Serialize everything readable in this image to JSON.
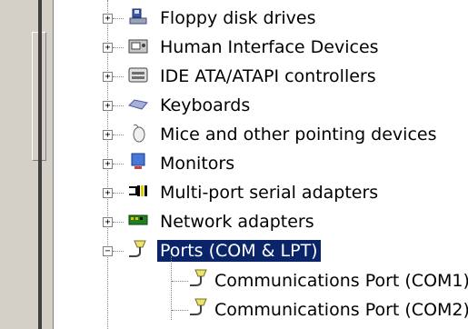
{
  "tree": {
    "items": [
      {
        "label": "Floppy disk drives",
        "icon": "floppy-drive-icon",
        "expanded": false
      },
      {
        "label": "Human Interface Devices",
        "icon": "hid-icon",
        "expanded": false
      },
      {
        "label": "IDE ATA/ATAPI controllers",
        "icon": "ide-controller-icon",
        "expanded": false
      },
      {
        "label": "Keyboards",
        "icon": "keyboard-icon",
        "expanded": false
      },
      {
        "label": "Mice and other pointing devices",
        "icon": "mouse-icon",
        "expanded": false
      },
      {
        "label": "Monitors",
        "icon": "monitor-icon",
        "expanded": false
      },
      {
        "label": "Multi-port serial adapters",
        "icon": "serial-adapter-icon",
        "expanded": false
      },
      {
        "label": "Network adapters",
        "icon": "network-adapter-icon",
        "expanded": false
      },
      {
        "label": "Ports (COM & LPT)",
        "icon": "port-icon",
        "expanded": true,
        "selected": true
      }
    ],
    "children": [
      {
        "label": "Communications Port (COM1)",
        "icon": "port-icon"
      },
      {
        "label": "Communications Port (COM2)",
        "icon": "port-icon"
      }
    ]
  },
  "colors": {
    "selection": "#0a246a",
    "panel": "#d4d0c8"
  }
}
